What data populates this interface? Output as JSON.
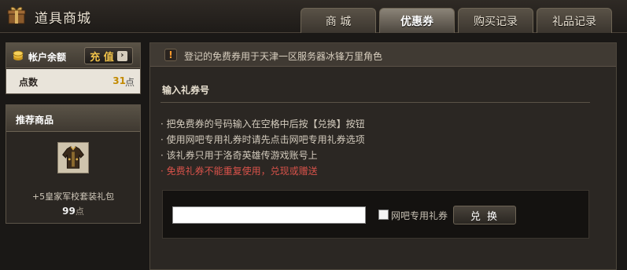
{
  "header": {
    "title": "道具商城",
    "tabs": [
      {
        "label": "商 城",
        "active": false
      },
      {
        "label": "优惠券",
        "active": true
      },
      {
        "label": "购买记录",
        "active": false
      },
      {
        "label": "礼品记录",
        "active": false
      }
    ]
  },
  "balance": {
    "label": "帐户余额",
    "recharge_label": "充 值",
    "points_label": "点数",
    "points_value": "31",
    "points_unit": "点"
  },
  "recommend": {
    "title": "推荐商品",
    "product_name": "+5皇家军校套装礼包",
    "product_price": "99",
    "product_price_unit": "点"
  },
  "notice": {
    "text": "登记的免费券用于天津一区服务器冰锋万里角色"
  },
  "coupon": {
    "section_title": "输入礼券号",
    "tips": [
      "· 把免费券的号码输入在空格中后按【兑换】按钮",
      "· 使用网吧专用礼券时请先点击网吧专用礼券选项",
      "· 该礼券只用于洛奇英雄传游戏账号上",
      "· 免费礼券不能重复使用，兑现或赠送"
    ],
    "code_value": "",
    "cafe_label": "网吧专用礼券",
    "redeem_label": "兑 换"
  },
  "colors": {
    "accent_gold": "#f0c24a",
    "warning_red": "#d8524a"
  },
  "icons": {
    "gift": "gift-icon",
    "coin": "coin-icon",
    "warning": "warning-icon"
  }
}
